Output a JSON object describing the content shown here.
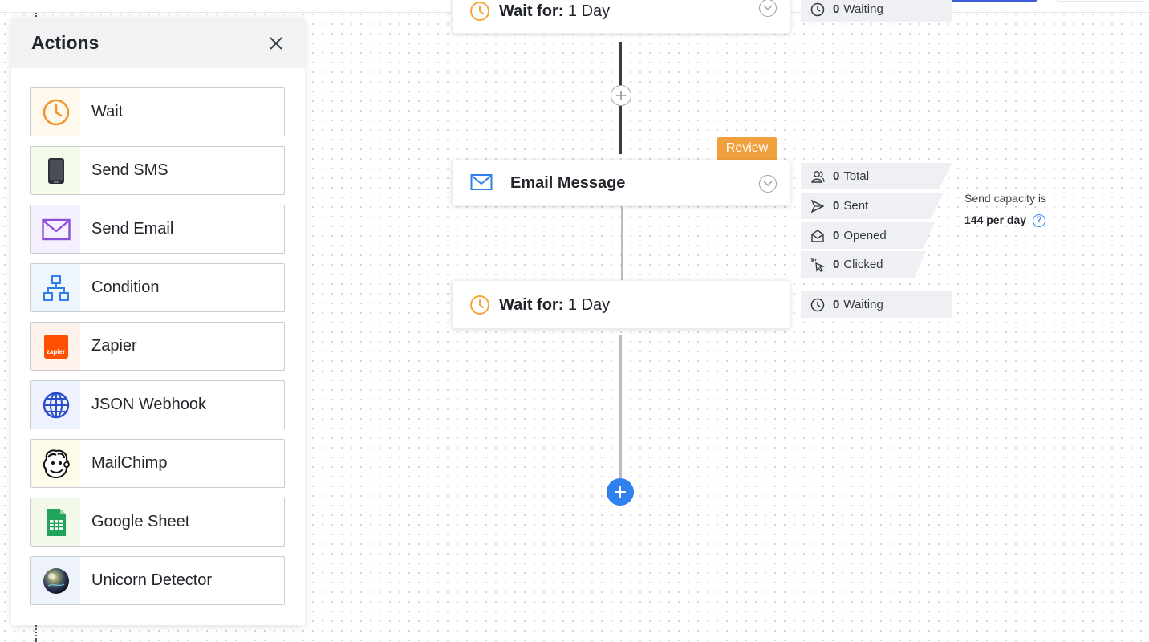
{
  "panel": {
    "title": "Actions",
    "items": [
      {
        "label": "Wait",
        "icon": "clock-icon",
        "bg": "#fff8ec"
      },
      {
        "label": "Send SMS",
        "icon": "phone-icon",
        "bg": "#f4fbea"
      },
      {
        "label": "Send Email",
        "icon": "envelope-icon",
        "bg": "#f5f0fd"
      },
      {
        "label": "Condition",
        "icon": "hierarchy-icon",
        "bg": "#eef5fd"
      },
      {
        "label": "Zapier",
        "icon": "zapier-logo-icon",
        "bg": "#fdf3ec"
      },
      {
        "label": "JSON Webhook",
        "icon": "globe-icon",
        "bg": "#eef2fd"
      },
      {
        "label": "MailChimp",
        "icon": "mailchimp-logo-icon",
        "bg": "#fdfbe9"
      },
      {
        "label": "Google Sheet",
        "icon": "google-sheet-icon",
        "bg": "#f2f9ea"
      },
      {
        "label": "Unicorn Detector",
        "icon": "unicorn-orb-icon",
        "bg": "#eef3fb"
      }
    ],
    "zapier_logo_text": "zapier"
  },
  "flow": {
    "top_card": {
      "label": "Wait for:",
      "value": "1 Day"
    },
    "top_stat": {
      "count": "0",
      "label": "Waiting"
    },
    "email_card": {
      "title": "Email Message",
      "badge": "Review"
    },
    "email_stats": [
      {
        "count": "0",
        "label": "Total",
        "icon": "users-icon"
      },
      {
        "count": "0",
        "label": "Sent",
        "icon": "send-icon"
      },
      {
        "count": "0",
        "label": "Opened",
        "icon": "open-envelope-icon"
      },
      {
        "count": "0",
        "label": "Clicked",
        "icon": "cursor-click-icon"
      }
    ],
    "wait_card": {
      "label": "Wait for:",
      "value": "1 Day"
    },
    "wait_stat": {
      "count": "0",
      "label": "Waiting"
    },
    "capacity": {
      "line1": "Send capacity is",
      "line2": "144 per day",
      "help": "?"
    }
  },
  "colors": {
    "accent_blue": "#2f80ed",
    "review_orange": "#f0a03c",
    "wait_orange": "#f3a73b"
  }
}
